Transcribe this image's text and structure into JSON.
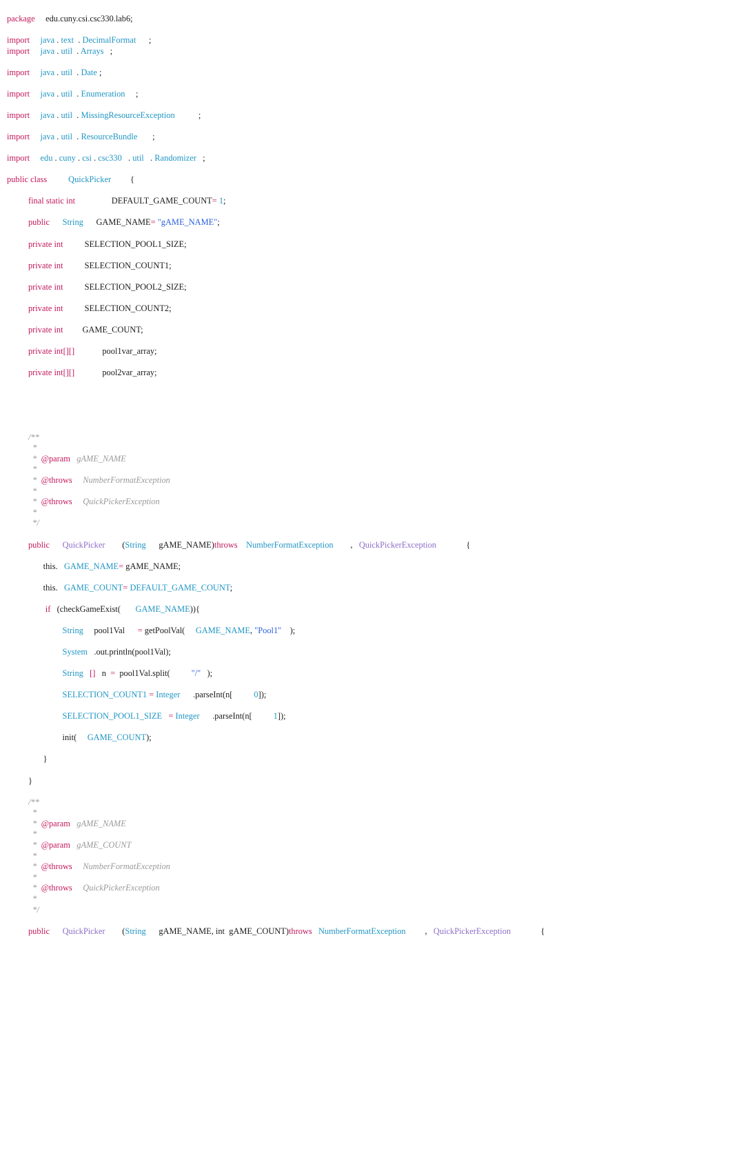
{
  "document": {
    "kind": "java-source-listing",
    "language": "Java",
    "package": "edu.cuny.csi.csc330.lab6",
    "class_name": "QuickPicker"
  },
  "palette": {
    "keyword": "#c2185b",
    "type": "#2196c4",
    "class": "#8d6fc9",
    "string": "#2b5fd9",
    "plain": "#1a1a1a",
    "comment": "#9a9a9a",
    "background": "#ffffff"
  },
  "code": {
    "package_kw": "package",
    "package_name": "edu.cuny.csi.csc330.lab6;",
    "import_kw": "import",
    "imports": [
      {
        "root": "java",
        "dot1": ".",
        "p1": "text",
        "dot2": ".",
        "p2": "DecimalFormat",
        "semi": ";"
      },
      {
        "root": "java",
        "dot1": ".",
        "p1": "util",
        "dot2": ".",
        "p2": "Arrays",
        "semi": ";"
      },
      {
        "root": "java",
        "dot1": ".",
        "p1": "util",
        "dot2": ".",
        "p2": "Date",
        "semi": ";"
      },
      {
        "root": "java",
        "dot1": ".",
        "p1": "util",
        "dot2": ".",
        "p2": "Enumeration",
        "semi": ";"
      },
      {
        "root": "java",
        "dot1": ".",
        "p1": "util",
        "dot2": ".",
        "p2": "MissingResourceException",
        "semi": ";"
      },
      {
        "root": "java",
        "dot1": ".",
        "p1": "util",
        "dot2": ".",
        "p2": "ResourceBundle",
        "semi": ";"
      }
    ],
    "import_randomizer": {
      "root": "edu",
      "d1": ".",
      "p1": "cuny",
      "d2": ".",
      "p2": "csi",
      "d3": ".",
      "p3": "csc330",
      "d4": ".",
      "p4": "util",
      "d5": ".",
      "p5": "Randomizer",
      "semi": ";"
    },
    "class_decl": {
      "modifier": "public class",
      "name": "QuickPicker",
      "brace": "{"
    },
    "fields": [
      {
        "mods": "final static int",
        "name": "DEFAULT_GAME_COUNT",
        "op": "=",
        "value": "1",
        "semi": ";"
      },
      {
        "mods": "public",
        "type": "String",
        "name": "GAME_NAME",
        "op": "=",
        "value": "\"gAME_NAME\"",
        "semi": ";"
      },
      {
        "mods": "private int",
        "name": "SELECTION_POOL1_SIZE;"
      },
      {
        "mods": "private int",
        "name": "SELECTION_COUNT1;"
      },
      {
        "mods": "private int",
        "name": "SELECTION_POOL2_SIZE;"
      },
      {
        "mods": "private int",
        "name": "SELECTION_COUNT2;"
      },
      {
        "mods": "private int",
        "name": "GAME_COUNT;"
      },
      {
        "mods": "private int[][]",
        "name": "pool1var_array;"
      },
      {
        "mods": "private int[][]",
        "name": "pool2var_array;"
      }
    ],
    "javadoc1": {
      "open": "/**",
      "star": "*",
      "param_tag": "@param",
      "param_name": "gAME_NAME",
      "throws_tag": "@throws",
      "throws1": "NumberFormatException",
      "throws2": "QuickPickerException",
      "close": "*/"
    },
    "ctor1": {
      "modifier": "public",
      "name": "QuickPicker",
      "lparen": "(",
      "ptype": "String",
      "pname": "gAME_NAME",
      "rparen": ")",
      "throws_kw": "throws",
      "ex1": "NumberFormatException",
      "comma": ",",
      "ex2": "QuickPickerException",
      "brace": "{"
    },
    "ctor1_body": {
      "assign_name": {
        "this": "this.",
        "field": "GAME_NAME",
        "op": "=",
        "value": "gAME_NAME;"
      },
      "assign_count": {
        "this": "this.",
        "field": "GAME_COUNT",
        "op": "=",
        "value": "DEFAULT_GAME_COUNT",
        "semi": ";"
      },
      "if_kw": "if",
      "if_cond_open": "(checkGameExist(",
      "if_cond_arg": "GAME_NAME",
      "if_cond_close": ")){",
      "pool1val": {
        "type": "String",
        "name": "pool1Val",
        "op": "=",
        "call": "getPoolVal(",
        "arg1": "GAME_NAME",
        "comma": ",",
        "arg2": "\"Pool1\"",
        "close": ");"
      },
      "println": {
        "sys": "System",
        "rest": ".out.println(pool1Val);"
      },
      "split": {
        "type": "String",
        "brackets": "[]",
        "name": "n",
        "op": "=",
        "call": "pool1Val.split(",
        "arg": "\"/\"",
        "close": ");"
      },
      "count1": {
        "field": "SELECTION_COUNT1",
        "op": "=",
        "wrapper": "Integer",
        "call": ".parseInt(n[",
        "index": "0",
        "close": "]);"
      },
      "pool1size": {
        "field": "SELECTION_POOL1_SIZE",
        "op": "=",
        "wrapper": "Integer",
        "call": ".parseInt(n[",
        "index": "1",
        "close": "]);"
      },
      "init_call": {
        "call": "init(",
        "arg": "GAME_COUNT",
        "close": ");"
      },
      "close_inner": "}",
      "close_ctor": "}"
    },
    "javadoc2": {
      "open": "/**",
      "star": "*",
      "param_tag": "@param",
      "param_name1": "gAME_NAME",
      "param_name2": "gAME_COUNT",
      "throws_tag": "@throws",
      "throws1": "NumberFormatException",
      "throws2": "QuickPickerException",
      "close": "*/"
    },
    "ctor2": {
      "modifier": "public",
      "name": "QuickPicker",
      "lparen": "(",
      "ptype": "String",
      "pname1": "gAME_NAME, int",
      "pname2": "gAME_COUNT",
      "rparen": ")",
      "throws_kw": "throws",
      "ex1": "NumberFormatException",
      "comma": ",",
      "ex2": "QuickPickerException",
      "brace": "{"
    }
  }
}
